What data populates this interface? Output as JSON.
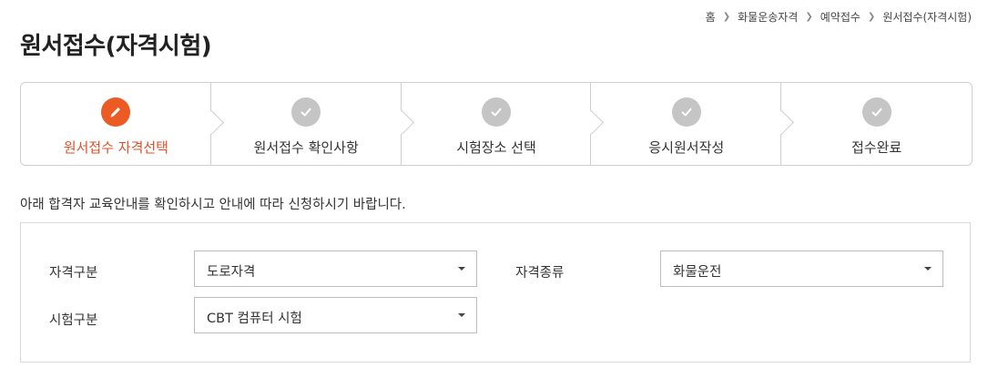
{
  "breadcrumb": [
    "홈",
    "화물운송자격",
    "예약접수",
    "원서접수(자격시험)"
  ],
  "page_title": "원서접수(자격시험)",
  "steps": [
    {
      "label": "원서접수 자격선택",
      "state": "active",
      "icon": "pencil-icon"
    },
    {
      "label": "원서접수 확인사항",
      "state": "done",
      "icon": "check-icon"
    },
    {
      "label": "시험장소 선택",
      "state": "done",
      "icon": "check-icon"
    },
    {
      "label": "응시원서작성",
      "state": "done",
      "icon": "check-icon"
    },
    {
      "label": "접수완료",
      "state": "done",
      "icon": "check-icon"
    }
  ],
  "notice": "아래 합격자 교육안내를 확인하시고 안내에 따라 신청하시기 바랍니다.",
  "form": {
    "qual_category_label": "자격구분",
    "qual_category_value": "도로자격",
    "qual_type_label": "자격종류",
    "qual_type_value": "화물운전",
    "exam_category_label": "시험구분",
    "exam_category_value": "CBT 컴퓨터 시험"
  },
  "colors": {
    "accent": "#ec5b24",
    "active_text": "#e0502a",
    "done_icon": "#c5c5c5",
    "border": "#cfcfcf"
  }
}
